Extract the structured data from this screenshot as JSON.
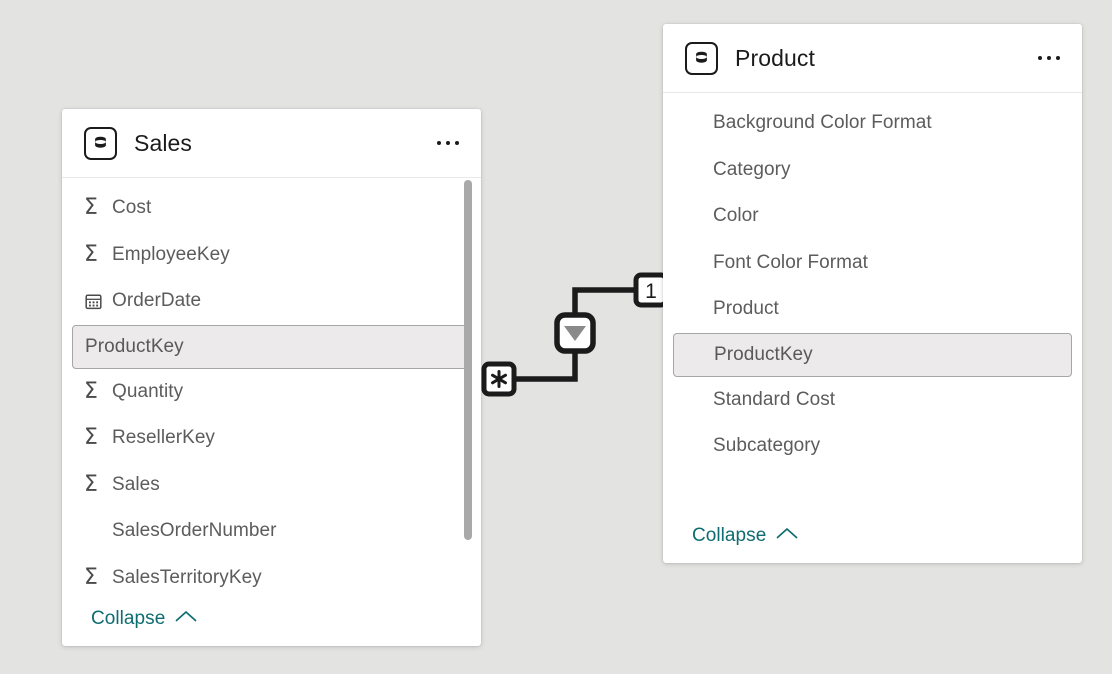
{
  "canvas": {
    "background_color": "#e3e3e1"
  },
  "tables": [
    {
      "id": "sales",
      "name": "Sales",
      "icon": "table-database-icon",
      "menu_icon": "ellipsis-icon",
      "collapse_label": "Collapse",
      "collapse_icon": "chevron-up-icon",
      "has_scrollbar": true,
      "fields": [
        {
          "name": "Cost",
          "icon": "sigma-icon",
          "selected": false
        },
        {
          "name": "EmployeeKey",
          "icon": "sigma-icon",
          "selected": false
        },
        {
          "name": "OrderDate",
          "icon": "calendar-icon",
          "selected": false
        },
        {
          "name": "ProductKey",
          "icon": "none",
          "selected": true
        },
        {
          "name": "Quantity",
          "icon": "sigma-icon",
          "selected": false
        },
        {
          "name": "ResellerKey",
          "icon": "sigma-icon",
          "selected": false
        },
        {
          "name": "Sales",
          "icon": "sigma-icon",
          "selected": false
        },
        {
          "name": "SalesOrderNumber",
          "icon": "none",
          "selected": false
        },
        {
          "name": "SalesTerritoryKey",
          "icon": "sigma-icon",
          "selected": false
        }
      ]
    },
    {
      "id": "product",
      "name": "Product",
      "icon": "table-database-icon",
      "menu_icon": "ellipsis-icon",
      "collapse_label": "Collapse",
      "collapse_icon": "chevron-up-icon",
      "has_scrollbar": false,
      "fields": [
        {
          "name": "Background Color Format",
          "icon": "none",
          "selected": false
        },
        {
          "name": "Category",
          "icon": "none",
          "selected": false
        },
        {
          "name": "Color",
          "icon": "none",
          "selected": false
        },
        {
          "name": "Font Color Format",
          "icon": "none",
          "selected": false
        },
        {
          "name": "Product",
          "icon": "none",
          "selected": false
        },
        {
          "name": "ProductKey",
          "icon": "none",
          "selected": true
        },
        {
          "name": "Standard Cost",
          "icon": "none",
          "selected": false
        },
        {
          "name": "Subcategory",
          "icon": "none",
          "selected": false
        }
      ]
    }
  ],
  "relationship": {
    "from_table": "Sales",
    "from_field": "ProductKey",
    "from_cardinality": "*",
    "to_table": "Product",
    "to_field": "ProductKey",
    "to_cardinality": "1",
    "cross_filter_direction": "single",
    "filter_arrow_icon": "filter-direction-down-icon",
    "line_color": "#1b1b1b"
  },
  "colors": {
    "link": "#0f6d72",
    "field_text": "#5c5c5c",
    "title_text": "#1b1b1b",
    "card_background": "#ffffff",
    "selected_row_background": "#eceaea",
    "selected_row_border": "#a6a6a6",
    "scrollbar_thumb": "#a9a9a9"
  }
}
